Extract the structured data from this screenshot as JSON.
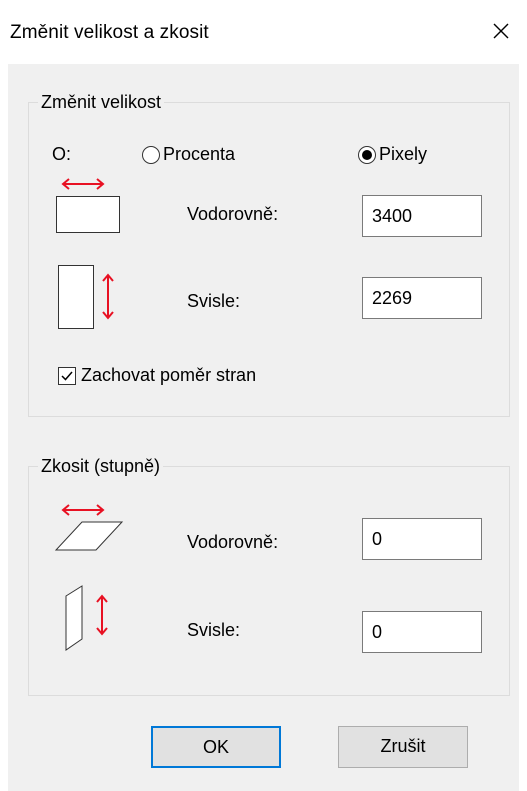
{
  "window": {
    "title": "Změnit velikost a zkosit"
  },
  "resize": {
    "group_label": "Změnit velikost",
    "by_label": "O:",
    "percent_label": "Procenta",
    "pixels_label": "Pixely",
    "selected_unit": "Pixely",
    "horizontal_label": "Vodorovně:",
    "horizontal_value": "3400",
    "vertical_label": "Svisle:",
    "vertical_value": "2269",
    "keep_ratio_label": "Zachovat poměr stran",
    "keep_ratio_checked": true
  },
  "skew": {
    "group_label": "Zkosit (stupně)",
    "horizontal_label": "Vodorovně:",
    "horizontal_value": "0",
    "vertical_label": "Svisle:",
    "vertical_value": "0"
  },
  "buttons": {
    "ok_label": "OK",
    "cancel_label": "Zrušit"
  },
  "colors": {
    "accent": "#0078d7",
    "arrow": "#e81123",
    "panel": "#f0f0f0"
  }
}
